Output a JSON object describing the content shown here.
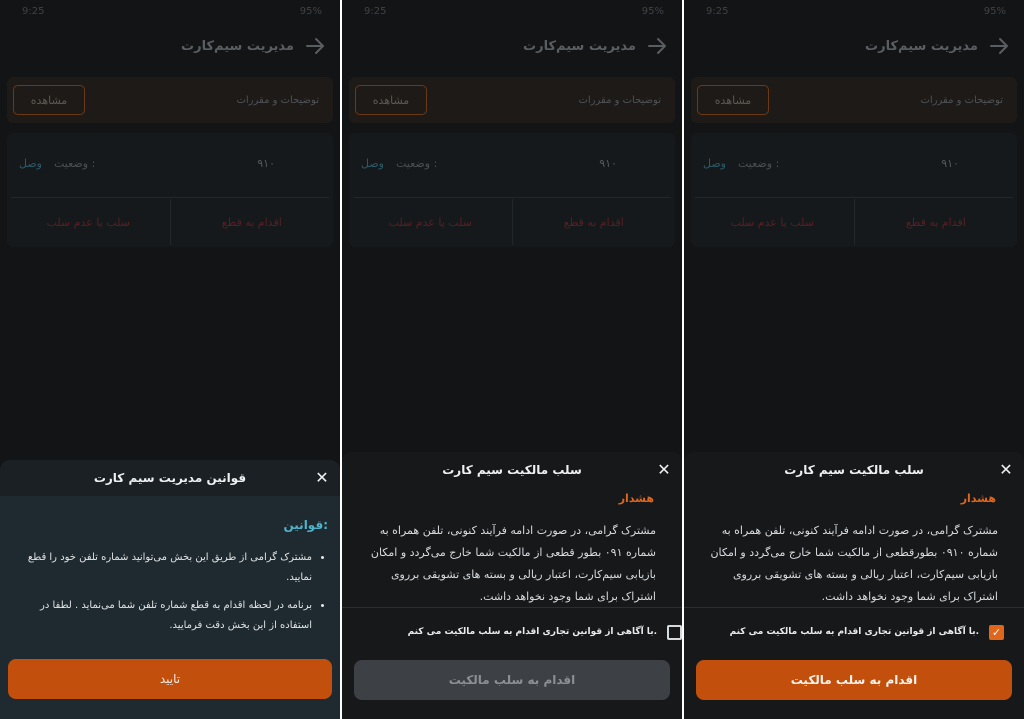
{
  "statusbar": {
    "time_left": "9:25",
    "battery": "95%"
  },
  "header": {
    "title": "مدیریت سیم‌کارت"
  },
  "terms_card": {
    "label": "توضیحات و مقررات",
    "view_button": "مشاهده"
  },
  "sim": {
    "number": "۹۱۰",
    "status_label": "وضعیت :",
    "status_value": "وصل",
    "action_disconnect": "اقدام به قطع",
    "action_revoke": "سلب یا عدم سلب"
  },
  "rules_sheet": {
    "title": "قوانین مدیریت سیم کارت",
    "heading": "قوانین:",
    "items": [
      "مشترک گرامی از طریق این بخش می‌توانید شماره تلفن خود را قطع نمایید.",
      "برنامه در لحظه اقدام به قطع شماره تلفن شما می‌نماید . لطفا در استفاده از این بخش دقت فرمایید."
    ],
    "confirm_button": "تایید"
  },
  "revoke_sheet": {
    "title": "سلب مالکیت سیم کارت",
    "warning_title": "هشدار",
    "warning_text_s2": "مشترک گرامی، در صورت ادامه فرآیند کنونی، تلفن همراه به شماره ۰۹۱ بطور قطعی از مالکیت شما خارج می‌گردد و امکان بازیابی سیم‌کارت، اعتبار ریالی و بسته های تشویقی برروی اشتراک برای شما وجود نخواهد داشت.",
    "warning_text_s3": "مشترک گرامی، در صورت ادامه فرآیند کنونی، تلفن همراه به شماره ۰۹۱۰ بطورقطعی از مالکیت شما خارج می‌گردد و امکان بازیابی سیم‌کارت، اعتبار ریالی و بسته های تشویقی برروی اشتراک برای شما وجود نخواهد داشت.",
    "agree_label": "با آگاهی از قوانین تجاری اقدام به سلب مالکیت می کنم.",
    "revoke_button": "اقدام به سلب مالکیت"
  },
  "colors": {
    "accent": "#c24f0c",
    "warning": "#e0661b",
    "link": "#4fb3c9"
  }
}
